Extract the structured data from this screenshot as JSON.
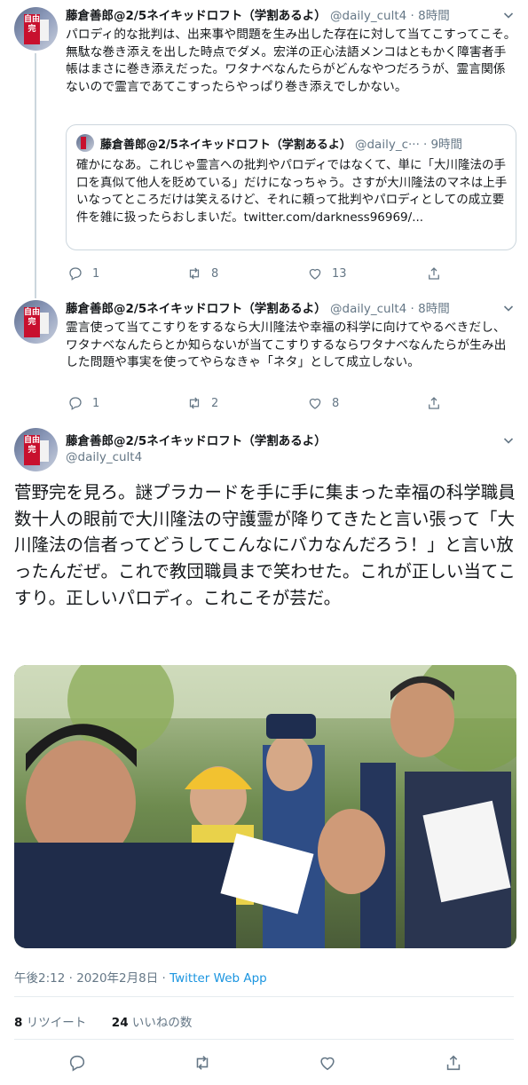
{
  "user": {
    "name": "藤倉善郎@2/5ネイキッドロフト（学割あるよ）",
    "handle": "@daily_cult4",
    "avatar_text": "自由完"
  },
  "tweets": [
    {
      "time": "8時間",
      "text": "パロディ的な批判は、出来事や問題を生み出した存在に対して当てこすってこそ。無駄な巻き添えを出した時点でダメ。宏洋の正心法語メンコはともかく障害者手帳はまさに巻き添えだった。ワタナベなんたらがどんなやつだろうが、霊言関係ないので霊言であてこすったらやっぱり巻き添えでしかない。",
      "quote": {
        "name": "藤倉善郎@2/5ネイキッドロフト（学割あるよ）",
        "handle": "@daily_c···",
        "time": "9時間",
        "text": "確かになあ。これじゃ霊言への批判やパロディではなくて、単に「大川隆法の手口を真似て他人を貶めている」だけになっちゃう。さすが大川隆法のマネは上手いなってところだけは笑えるけど、それに頼って批判やパロディとしての成立要件を雑に扱ったらおしまいだ。twitter.com/darkness96969/..."
      },
      "replies": "1",
      "retweets": "8",
      "likes": "13"
    },
    {
      "time": "8時間",
      "text": "霊言使って当てこすりをするなら大川隆法や幸福の科学に向けてやるべきだし、ワタナベなんたらとか知らないが当てこすりするならワタナベなんたらが生み出した問題や事実を使ってやらなきゃ「ネタ」として成立しない。",
      "replies": "1",
      "retweets": "2",
      "likes": "8"
    }
  ],
  "main_tweet": {
    "text": "菅野完を見ろ。謎プラカードを手に手に集まった幸福の科学職員数十人の眼前で大川隆法の守護霊が降りてきたと言い張って「大川隆法の信者ってどうしてこんなにバカなんだろう！」と言い放ったんだぜ。これで教団職員まで笑わせた。これが正しい当てこすり。正しいパロディ。これこそが芸だ。",
    "timestamp": "午後2:12 · 2020年2月8日 · ",
    "source": "Twitter Web App",
    "retweet_count": "8",
    "retweet_label": " リツイート",
    "like_count": "24",
    "like_label": " いいねの数"
  },
  "colors": {
    "text": "#14171a",
    "secondary": "#657786",
    "link": "#1b95e0",
    "border": "#e6ecf0"
  },
  "icons": [
    "chevron-down-icon",
    "reply-icon",
    "retweet-icon",
    "like-icon",
    "share-icon"
  ]
}
